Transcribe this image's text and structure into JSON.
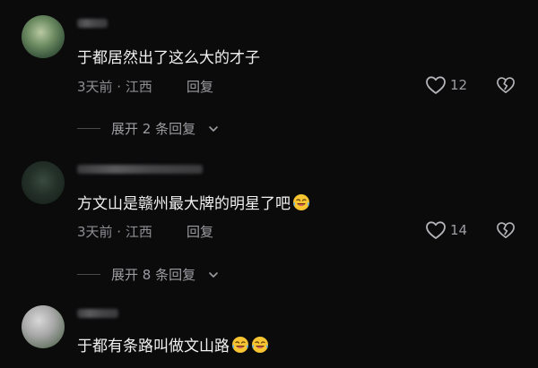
{
  "comments": [
    {
      "text": "于都居然出了这么大的才子",
      "time_location": "3天前 · 江西",
      "reply": "回复",
      "likes": "12",
      "expand": "展开 2 条回复"
    },
    {
      "text": "方文山是赣州最大牌的明星了吧",
      "time_location": "3天前 · 江西",
      "reply": "回复",
      "likes": "14",
      "expand": "展开 8 条回复"
    },
    {
      "text": "于都有条路叫做文山路"
    }
  ],
  "icons": {
    "like": "heart-outline-icon",
    "dislike": "broken-heart-icon",
    "expand": "chevron-down-icon",
    "emoji": "laughing-tears-emoji"
  },
  "colors": {
    "background": "#0b0b0c",
    "primary_text": "#f0f0f0",
    "secondary_text": "#8e8e93"
  }
}
